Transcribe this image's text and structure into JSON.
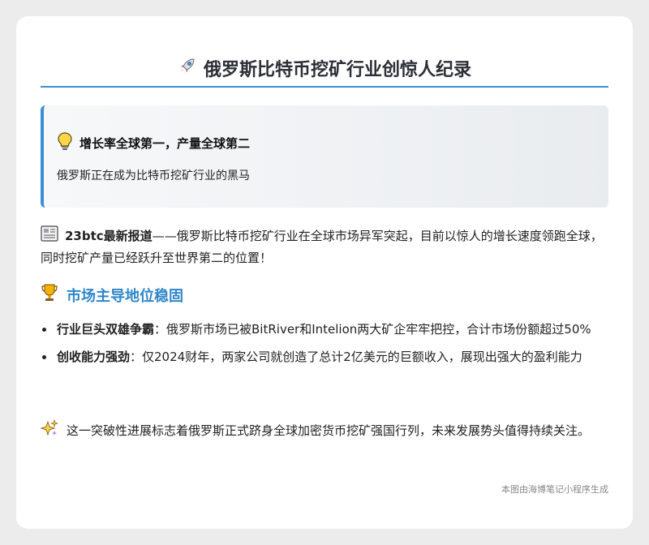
{
  "header": {
    "title_icon": "rocket-icon",
    "title": "俄罗斯比特币挖矿行业创惊人纪录"
  },
  "callout": {
    "icon": "lightbulb-icon",
    "heading": "增长率全球第一，产量全球第二",
    "subtext": "俄罗斯正在成为比特币挖矿行业的黑马"
  },
  "intro": {
    "icon": "newspaper-icon",
    "lead": "23btc最新报道",
    "text": "——俄罗斯比特币挖矿行业在全球市场异军突起，目前以惊人的增长速度领跑全球，同时挖矿产量已经跃升至世界第二的位置！"
  },
  "section": {
    "icon": "trophy-icon",
    "title": "市场主导地位稳固"
  },
  "points": [
    {
      "bold": "行业巨头双雄争霸",
      "text": "：俄罗斯市场已被BitRiver和Intelion两大矿企牢牢把控，合计市场份额超过50%"
    },
    {
      "bold": "创收能力强劲",
      "text": "：仅2024财年，两家公司就创造了总计2亿美元的巨额收入，展现出强大的盈利能力"
    }
  ],
  "closing": {
    "icon": "sparkles-icon",
    "text": "这一突破性进展标志着俄罗斯正式跻身全球加密货币挖矿强国行列，未来发展势头值得持续关注。"
  },
  "footer": {
    "text": "本图由海博笔记小程序生成"
  },
  "colors": {
    "accent": "#3a8fd6",
    "section_title": "#2f86c9",
    "page_bg": "#ececec",
    "card_bg": "#ffffff"
  }
}
